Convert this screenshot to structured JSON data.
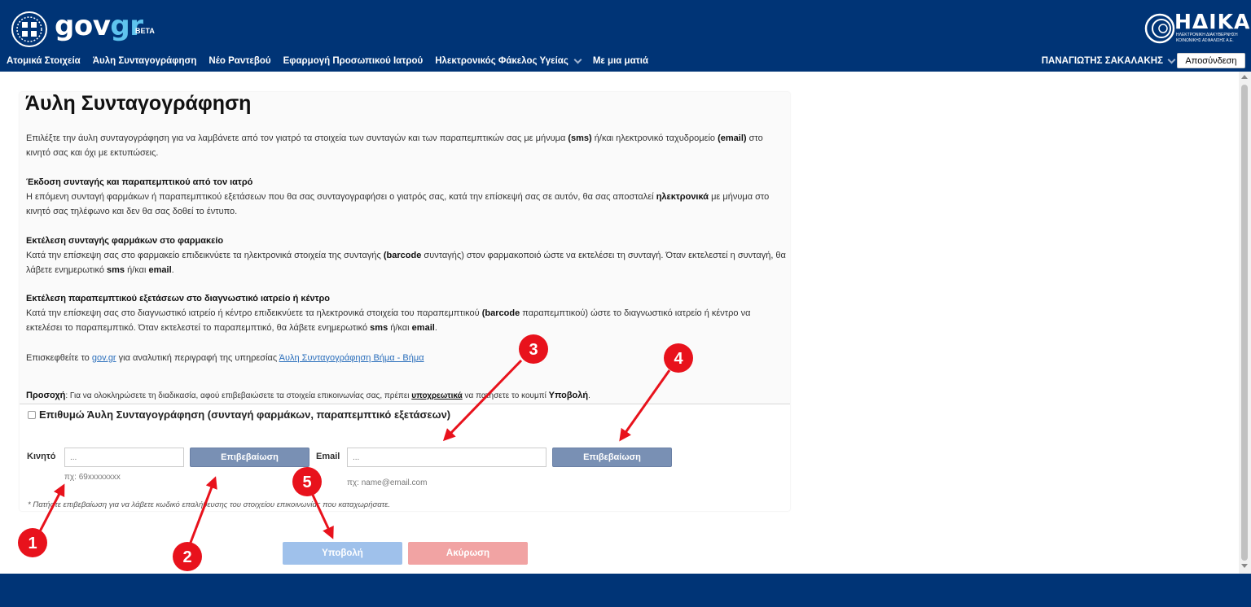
{
  "header": {
    "logo_main": "gov",
    "logo_accent": "gr",
    "logo_badge": "BETA",
    "partner_name": "ΗΔΙΚΑ",
    "partner_subtitle": "ΗΛΕΚΤΡΟΝΙΚΗ ΔΙΑΚΥΒΕΡΝΗΣΗ ΚΟΙΝΩΝΙΚΗΣ ΑΣΦΑΛΙΣΗΣ Α.Ε.",
    "nav": [
      {
        "label": "Ατομικά Στοιχεία"
      },
      {
        "label": "Άυλη Συνταγογράφηση"
      },
      {
        "label": "Νέο Ραντεβού"
      },
      {
        "label": "Εφαρμογή Προσωπικού Ιατρού"
      },
      {
        "label": "Ηλεκτρονικός Φάκελος Υγείας"
      },
      {
        "label": "Με μια ματιά"
      }
    ],
    "user_name": "ΠΑΝΑΓΙΩΤΗΣ ΣΑΚΑΛΑΚΗΣ",
    "logout_label": "Αποσύνδεση"
  },
  "page": {
    "title": "Άυλη Συνταγογράφηση",
    "intro_1": "Επιλέξτε την άυλη συνταγογράφηση για να λαμβάνετε από τον γιατρό τα στοιχεία των συνταγών και των παραπεμπτικών σας με μήνυμα ",
    "intro_sms": "(sms)",
    "intro_2": " ή/και ηλεκτρονικό ταχυδρομείο ",
    "intro_email": "(email)",
    "intro_3": " στο κινητό σας και όχι με εκτυπώσεις.",
    "s1_title": "Έκδοση συνταγής και παραπεμπτικού από τον ιατρό",
    "s1_text_1": "Η επόμενη συνταγή φαρμάκων ή παραπεμπτικού εξετάσεων που θα σας συνταγογραφήσει ο γιατρός σας, κατά την επίσκεψή σας σε αυτόν, θα σας αποσταλεί ",
    "s1_bold": "ηλεκτρονικά",
    "s1_text_2": " με μήνυμα στο κινητό σας τηλέφωνο και δεν θα σας δοθεί το έντυπο.",
    "s2_title": "Εκτέλεση συνταγής φαρμάκων στο φαρμακείο",
    "s2_text_1": "Κατά την επίσκεψη σας στο φαρμακείο επιδεικνύετε τα ηλεκτρονικά στοιχεία της συνταγής ",
    "s2_barcode": "(barcode",
    "s2_text_2": " συνταγής) στον φαρμακοποιό ώστε να εκτελέσει τη συνταγή. Όταν εκτελεστεί η συνταγή, θα λάβετε ενημερωτικό ",
    "s2_sms": "sms",
    "s2_text_3": " ή/και ",
    "s2_email": "email",
    "s2_text_4": ".",
    "s3_title": "Εκτέλεση παραπεμπτικού εξετάσεων στο διαγνωστικό ιατρείο ή κέντρο",
    "s3_text_1": "Κατά την επίσκεψη σας στο διαγνωστικό ιατρείο ή κέντρο επιδεικνύετε τα ηλεκτρονικά στοιχεία του παραπεμπτικού ",
    "s3_barcode": "(barcode",
    "s3_text_2": " παραπεμπτικού) ώστε το διαγνωστικό ιατρείο ή κέντρο να εκτελέσει το παραπεμπτικό. Όταν εκτελεστεί το παραπεμπτικό, θα λάβετε ενημερωτικό ",
    "s3_sms": "sms",
    "s3_text_3": " ή/και ",
    "s3_email": "email",
    "s3_text_4": ".",
    "visit_1": "Επισκεφθείτε το ",
    "visit_link": "gov.gr",
    "visit_2": " για αναλυτική περιγραφή της υπηρεσίας ",
    "visit_link2": "Άυλη Συνταγογράφηση Βήμα - Βήμα",
    "attention_label": "Προσοχή",
    "attention_1": ": Για να ολοκληρώσετε τη διαδικασία, αφού επιβεβαιώσετε τα στοιχεία επικοινωνίας σας, πρέπει ",
    "attention_must": "υποχρεωτικά",
    "attention_2": " να πατήσετε το κουμπί ",
    "attention_submit": "Υποβολή",
    "attention_3": "."
  },
  "form": {
    "checkbox_label": "Επιθυμώ Άυλη Συνταγογράφηση (συνταγή φαρμάκων, παραπεμπτικό εξετάσεων)",
    "mobile_label": "Κινητό",
    "mobile_placeholder": "...",
    "mobile_hint": "πχ: 69xxxxxxxx",
    "mobile_confirm": "Επιβεβαίωση",
    "email_label": "Email",
    "email_placeholder": "...",
    "email_hint": "πχ: name@email.com",
    "email_confirm": "Επιβεβαίωση",
    "note": "* Πατήστε επιβεβαίωση για να λάβετε κωδικό επαλήθευσης του στοιχείου επικοινωνίας που καταχωρήσατε.",
    "submit_label": "Υποβολή",
    "cancel_label": "Ακύρωση"
  },
  "annotations": {
    "markers": [
      "1",
      "2",
      "3",
      "4",
      "5"
    ],
    "color": "#e8121c"
  },
  "colors": {
    "header_bg": "#003476",
    "confirm_btn": "#7990b4",
    "submit_btn": "#9fc1eb",
    "cancel_btn": "#f1a3a3"
  }
}
